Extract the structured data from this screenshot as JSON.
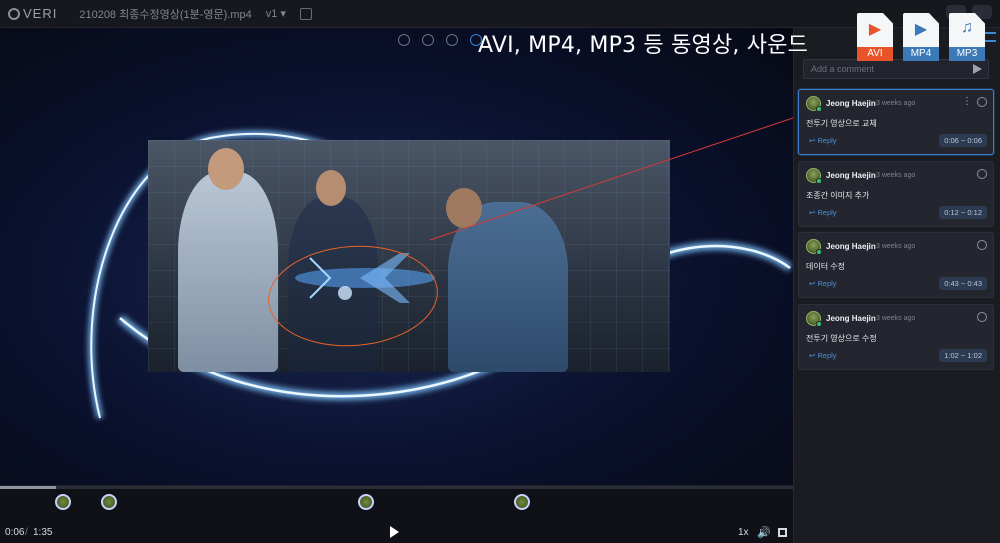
{
  "app": {
    "logo_text": "VERI",
    "file_name": "210208 최종수정영상(1분-영문).mp4",
    "version": "v1",
    "banner": "AVI, MP4, MP3 등 동영상, 사운드",
    "formats": [
      {
        "glyph": "▶",
        "label": "AVI",
        "color": "#e8532a"
      },
      {
        "glyph": "▶",
        "label": "MP4",
        "color": "#3c79b8"
      },
      {
        "glyph": "♫",
        "label": "MP3",
        "color": "#3c79b8"
      }
    ]
  },
  "player": {
    "current_time": "0:06",
    "separator": "/",
    "duration": "1:35",
    "progress_fraction": 0.07,
    "speed": "1x",
    "volume_icon": "volume-icon",
    "markers_fraction": [
      0.08,
      0.137,
      0.461,
      0.658
    ]
  },
  "sidebar": {
    "comment_placeholder": "Add a comment",
    "comments": [
      {
        "author": "Jeong Haejin",
        "ago": "3 weeks ago",
        "text": "전투기 영상으로 교체",
        "reply": "Reply",
        "range": "0:06 ~ 0:06",
        "active": true
      },
      {
        "author": "Jeong Haejin",
        "ago": "3 weeks ago",
        "text": "조종간 이미지 추가",
        "reply": "Reply",
        "range": "0:12 ~ 0:12",
        "active": false
      },
      {
        "author": "Jeong Haejin",
        "ago": "3 weeks ago",
        "text": "데이터 수정",
        "reply": "Reply",
        "range": "0:43 ~ 0:43",
        "active": false
      },
      {
        "author": "Jeong Haejin",
        "ago": "3 weeks ago",
        "text": "전투기 영상으로 수정",
        "reply": "Reply",
        "range": "1:02 ~ 1:02",
        "active": false
      }
    ]
  },
  "colors": {
    "accent": "#3a7fd0",
    "annotation": "#e8632a",
    "reply_link": "#4f8ed6"
  }
}
